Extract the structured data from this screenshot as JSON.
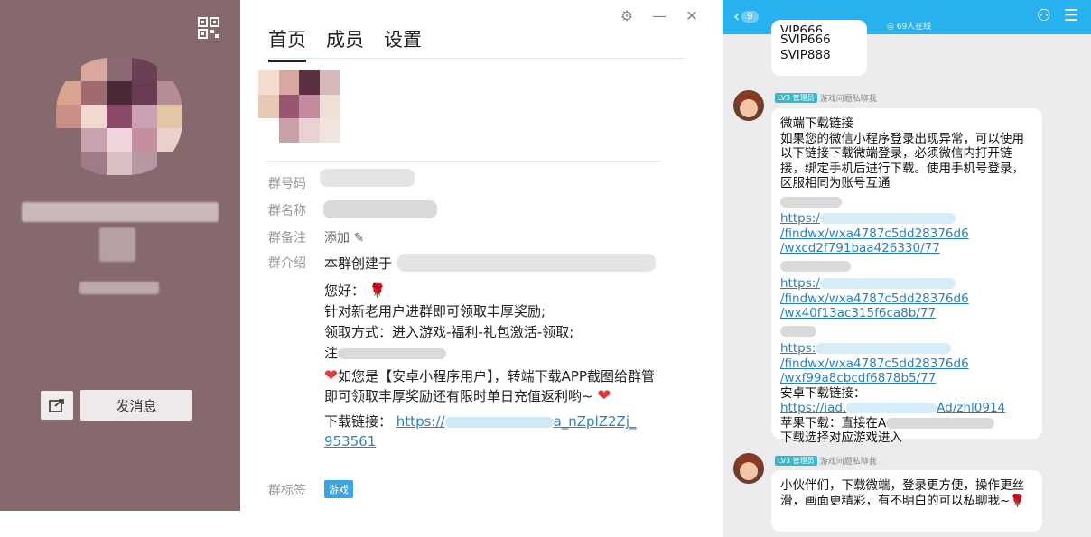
{
  "profile": {
    "tabs": [
      "首页",
      "成员",
      "设置"
    ],
    "rows": {
      "group_code_label": "群号码",
      "group_name_label": "群名称",
      "group_note_label": "群备注",
      "group_note_value": "添加",
      "group_intro_label": "群介绍",
      "group_tag_label": "群标签",
      "group_tag_value": "游戏"
    },
    "intro": {
      "line1_prefix": "本群创建于",
      "greeting": "您好：",
      "line2": "针对新老用户进群即可领取丰厚奖励;",
      "line3": "领取方式：进入游戏-福利-礼包激活-领取;",
      "line4_prefix": "注",
      "line5": "如您是【安卓小程序用户】，转端下载APP截图给群管即可领取丰厚奖励还有限时单日充值返利哟~",
      "download_label": "下载链接：",
      "download_link_a": "https://",
      "download_link_b": "a_nZplZ2Zj_",
      "download_link_c": "953561"
    },
    "send_message_label": "发消息"
  },
  "chat": {
    "header": {
      "back_count": "9",
      "online": "◎ 69人在线"
    },
    "messages": [
      {
        "lines": [
          "VIP666",
          "SVIP666",
          "SVIP888"
        ]
      },
      {
        "admin_tag": "管理员",
        "level_tag": "LV3",
        "title": "游戏问题私聊我",
        "text_lines": [
          "微端下载链接",
          "如果您的微信小程序登录出现异常，可以使用以下链接下载微端登录，必须微信内打开链接，绑定手机后进行下载。使用手机号登录，区服相同为账号互通"
        ],
        "link1": [
          "https:/",
          "/findwx/wxa4787c5dd28376d6",
          "/wxcd2f791baa426330/77"
        ],
        "link2": [
          "https:/",
          "/findwx/wxa4787c5dd28376d6",
          "/wx40f13ac315f6ca8b/77"
        ],
        "link3": [
          "https:",
          "/findwx/wxa4787c5dd28376d6",
          "/wxf99a8cbcdf6878b5/77"
        ],
        "android_label": "安卓下载链接：",
        "android_link_a": "https://iad.",
        "android_link_b": "Ad/zhl0914",
        "apple_line": "苹果下载：直接在A",
        "apple_line2": "下载选择对应游戏进入"
      },
      {
        "admin_tag": "管理员",
        "level_tag": "LV3",
        "title": "游戏问题私聊我",
        "text": "小伙伴们，下载微端，登录更方便，操作更丝滑，画面更精彩，有不明白的可以私聊我~"
      }
    ]
  }
}
